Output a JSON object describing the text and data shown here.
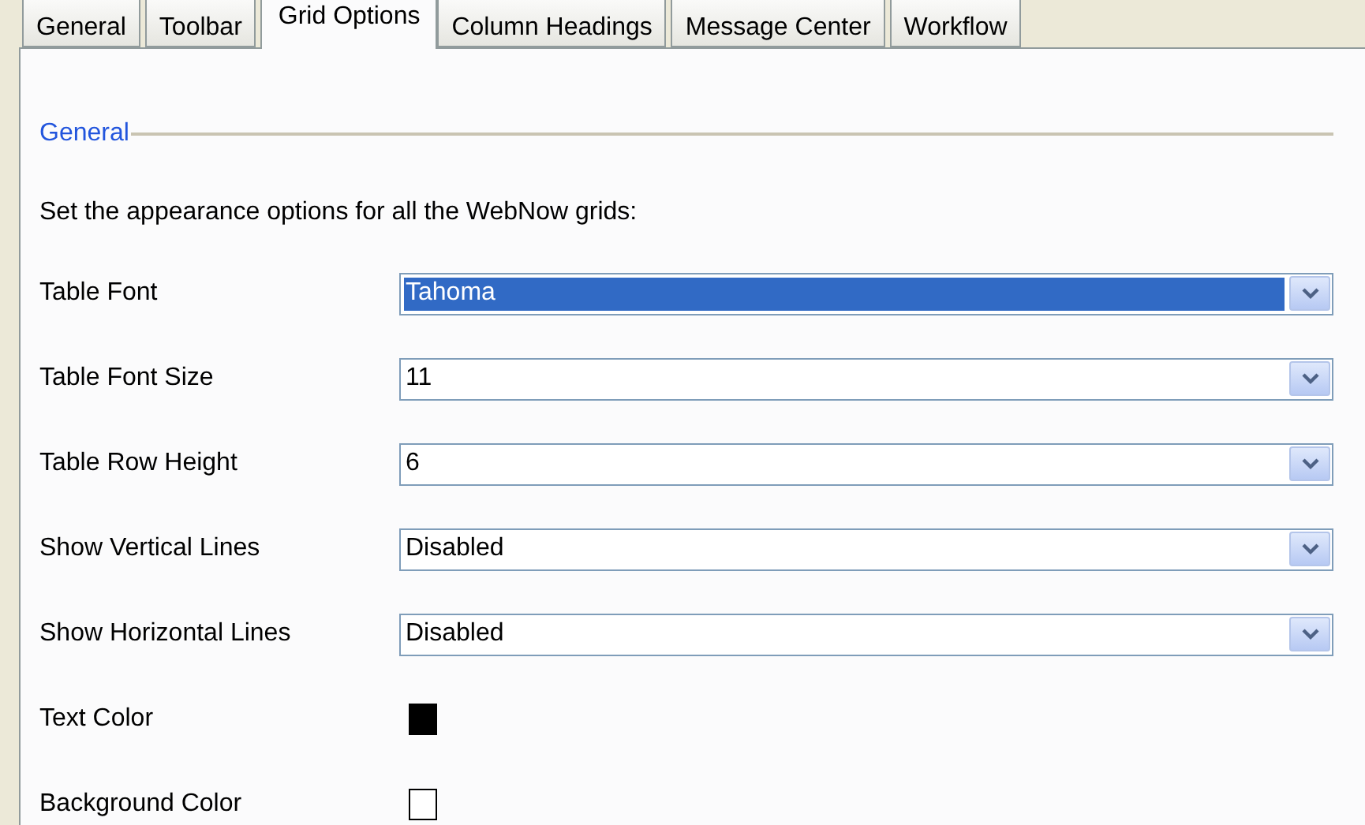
{
  "tabs": [
    {
      "label": "General",
      "selected": false
    },
    {
      "label": "Toolbar",
      "selected": false
    },
    {
      "label": "Grid Options",
      "selected": true
    },
    {
      "label": "Column Headings",
      "selected": false
    },
    {
      "label": "Message Center",
      "selected": false
    },
    {
      "label": "Workflow",
      "selected": false
    }
  ],
  "group": {
    "title": "General",
    "description": "Set the appearance options for all the WebNow grids:"
  },
  "settings": [
    {
      "kind": "select",
      "label": "Table Font",
      "value": "Tahoma",
      "highlighted": true
    },
    {
      "kind": "select",
      "label": "Table Font Size",
      "value": "11",
      "highlighted": false
    },
    {
      "kind": "select",
      "label": "Table Row Height",
      "value": "6",
      "highlighted": false
    },
    {
      "kind": "select",
      "label": "Show Vertical Lines",
      "value": "Disabled",
      "highlighted": false
    },
    {
      "kind": "select",
      "label": "Show Horizontal Lines",
      "value": "Disabled",
      "highlighted": false
    },
    {
      "kind": "color",
      "label": "Text Color",
      "color": "#000000"
    },
    {
      "kind": "color",
      "label": "Background Color",
      "color": "#ffffff"
    }
  ]
}
